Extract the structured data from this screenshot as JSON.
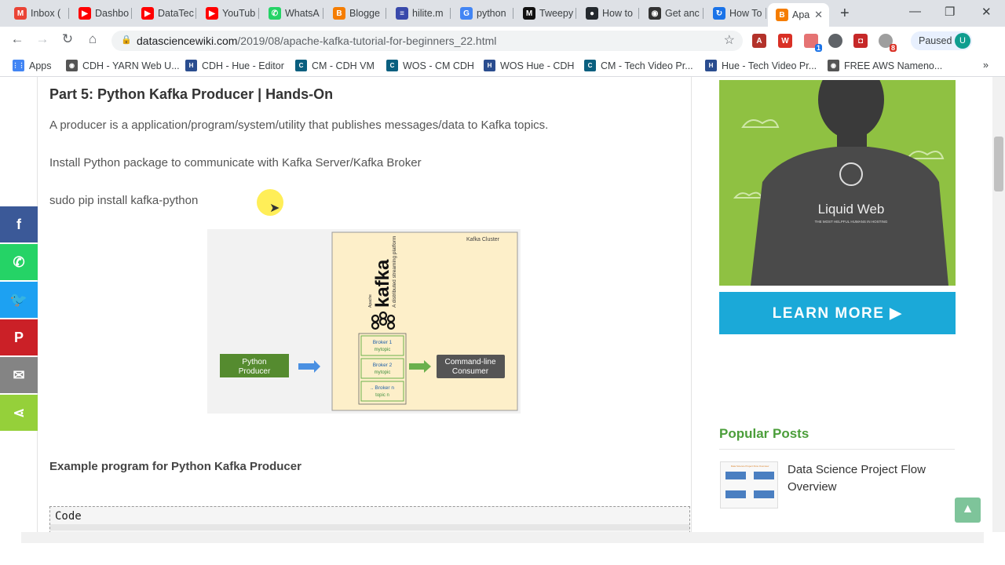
{
  "browser": {
    "tabs": [
      {
        "label": "Inbox (",
        "icon": "gmail-icon",
        "color": "#ea4335",
        "glyph": "M"
      },
      {
        "label": "Dashbo",
        "icon": "youtube-icon",
        "color": "#ff0000",
        "glyph": "▶"
      },
      {
        "label": "DataTec",
        "icon": "youtube-icon",
        "color": "#ff0000",
        "glyph": "▶"
      },
      {
        "label": "YouTub",
        "icon": "youtube-icon",
        "color": "#ff0000",
        "glyph": "▶"
      },
      {
        "label": "WhatsA",
        "icon": "whatsapp-icon",
        "color": "#25d366",
        "glyph": "✆"
      },
      {
        "label": "Blogge",
        "icon": "blogger-icon",
        "color": "#f57d00",
        "glyph": "B"
      },
      {
        "label": "hilite.m",
        "icon": "hilite-icon",
        "color": "#3949ab",
        "glyph": "≡"
      },
      {
        "label": "python",
        "icon": "google-icon",
        "color": "#4285f4",
        "glyph": "G"
      },
      {
        "label": "Tweepy",
        "icon": "medium-icon",
        "color": "#111111",
        "glyph": "M"
      },
      {
        "label": "How to",
        "icon": "github-icon",
        "color": "#24292e",
        "glyph": "●"
      },
      {
        "label": "Get anc",
        "icon": "globe-icon",
        "color": "#333333",
        "glyph": "◉"
      },
      {
        "label": "How To",
        "icon": "refresh-icon",
        "color": "#1a73e8",
        "glyph": "↻"
      },
      {
        "label": "Apa",
        "icon": "blogger-icon",
        "color": "#f57d00",
        "glyph": "B"
      }
    ],
    "new_tab": "+",
    "window_controls": {
      "minimize": "—",
      "restore": "❐",
      "close": "✕"
    },
    "url_domain": "datasciencewiki.com",
    "url_path": "/2019/08/apache-kafka-tutorial-for-beginners_22.html",
    "profile_status": "Paused",
    "profile_initial": "U",
    "extension_badges": {
      "notifications": "1",
      "alerts": "8"
    },
    "bookmarks": [
      {
        "label": "Apps",
        "icon": "apps-grid-icon",
        "color": "#4285f4",
        "glyph": "⋮⋮"
      },
      {
        "label": "CDH - YARN Web U...",
        "icon": "globe-icon",
        "color": "#555555",
        "glyph": "◉"
      },
      {
        "label": "CDH - Hue - Editor",
        "icon": "hue-icon",
        "color": "#2a4d8f",
        "glyph": "H"
      },
      {
        "label": "CM - CDH VM",
        "icon": "cloudera-icon",
        "color": "#0a5f7f",
        "glyph": "C"
      },
      {
        "label": "WOS - CM CDH",
        "icon": "cloudera-icon",
        "color": "#0a5f7f",
        "glyph": "C"
      },
      {
        "label": "WOS Hue - CDH",
        "icon": "hue-icon",
        "color": "#2a4d8f",
        "glyph": "H"
      },
      {
        "label": "CM - Tech Video Pr...",
        "icon": "cloudera-icon",
        "color": "#0a5f7f",
        "glyph": "C"
      },
      {
        "label": "Hue - Tech Video Pr...",
        "icon": "hue-icon",
        "color": "#2a4d8f",
        "glyph": "H"
      },
      {
        "label": "FREE AWS Nameno...",
        "icon": "globe-icon",
        "color": "#555555",
        "glyph": "◉"
      }
    ],
    "more_bookmarks": "»"
  },
  "article": {
    "heading": "Part 5: Python Kafka Producer | Hands-On",
    "para1": "A producer is a application/program/system/utility that publishes messages/data to Kafka topics.",
    "para2": "Install Python package to communicate with Kafka Server/Kafka Broker",
    "para3": "sudo pip install kafka-python",
    "example_title": "Example program for Python Kafka Producer",
    "code_label": "Code"
  },
  "diagram": {
    "cluster_label": "Kafka Cluster",
    "kafka_word": "kafka",
    "kafka_tagline": "A distributed streaming platform",
    "apache_word": "Apache",
    "producer_line1": "Python",
    "producer_line2": "Producer",
    "consumer_line1": "Command-line",
    "consumer_line2": "Consumer",
    "brokers": [
      {
        "name": "Broker 1",
        "topic": "mytopic"
      },
      {
        "name": "Broker 2",
        "topic": "mytopic"
      },
      {
        "name": ".. Broker n",
        "topic": "topic n"
      }
    ]
  },
  "share_buttons": [
    {
      "name": "facebook",
      "icon": "facebook-icon",
      "glyph": "f",
      "color": "#3b5998"
    },
    {
      "name": "whatsapp",
      "icon": "whatsapp-icon",
      "glyph": "✆",
      "color": "#25d366"
    },
    {
      "name": "twitter",
      "icon": "twitter-icon",
      "glyph": "🐦",
      "color": "#1da1f2"
    },
    {
      "name": "pinterest",
      "icon": "pinterest-icon",
      "glyph": "P",
      "color": "#cb2027"
    },
    {
      "name": "email",
      "icon": "email-icon",
      "glyph": "✉",
      "color": "#848484"
    },
    {
      "name": "sharethis",
      "icon": "share-icon",
      "glyph": "⋖",
      "color": "#95d03a"
    }
  ],
  "sidebar": {
    "ad_brand": "Liquid Web",
    "ad_shirt_tagline": "THE MOST HELPFUL HUMANS IN HOSTING",
    "ad_button": "LEARN MORE ▶",
    "popular_title": "Popular Posts",
    "popular_posts": [
      {
        "title": "Data Science Project Flow Overview",
        "thumb_caption": "Data Science Project Flow Overview"
      }
    ],
    "back_to_top": "▲"
  },
  "colors": {
    "accent_green": "#4b9e3a",
    "ad_blue": "#1ba9d8",
    "ad_green": "#8fc142"
  }
}
